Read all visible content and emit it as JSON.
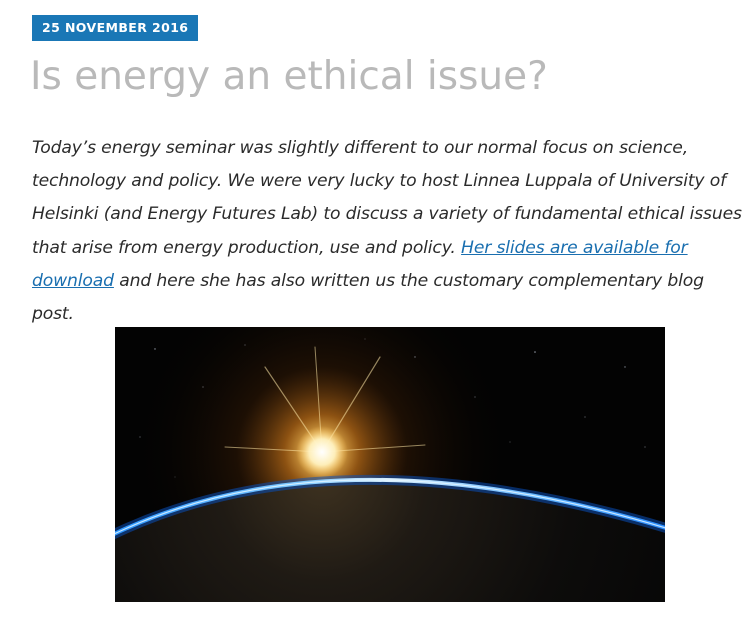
{
  "post": {
    "date": "25 NOVEMBER 2016",
    "title": "Is energy an ethical issue?"
  },
  "intro": {
    "text_before_link": "Today’s energy seminar was slightly different to our normal focus on science, technology and policy. We were very lucky to host Linnea Luppala of  University of Helsinki (and Energy Futures Lab) to discuss a variety of fundamental ethical issues that arise from energy production, use and policy. ",
    "link_text": "Her slides are available for download",
    "text_after_link": " and here she has also written us the customary complementary blog post."
  },
  "colors": {
    "date_badge_bg": "#1a77b6",
    "title": "#b9b9b9",
    "body_text": "#2b2b2b",
    "link": "#1a6fb0"
  },
  "image": {
    "subject": "earth-sunrise-from-space"
  }
}
